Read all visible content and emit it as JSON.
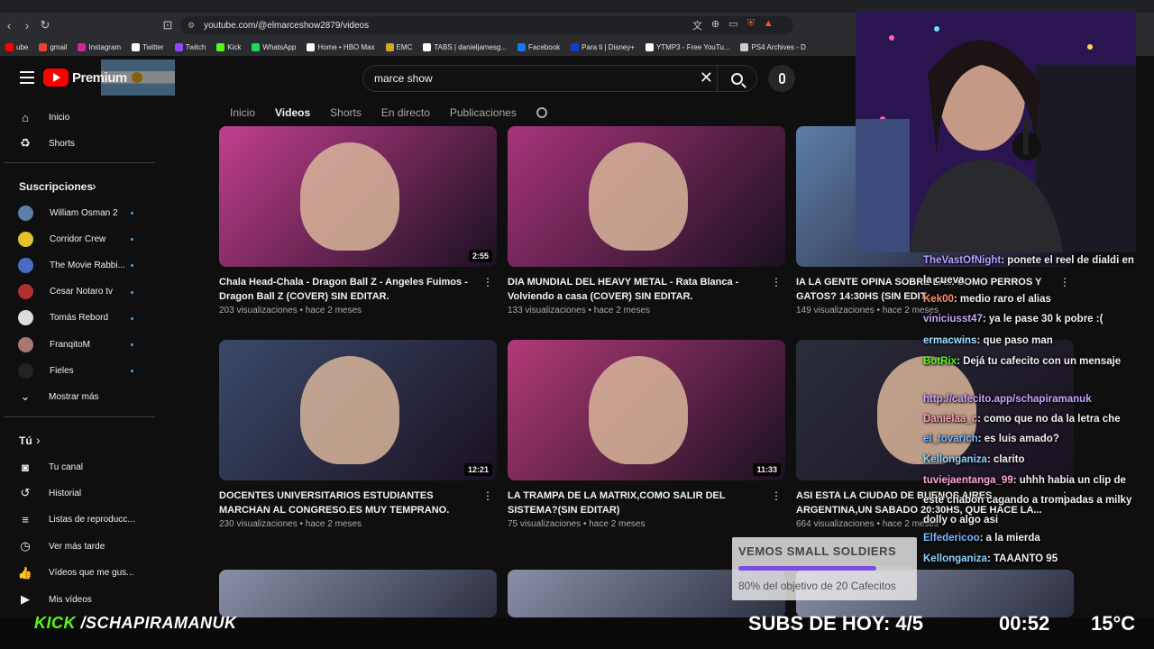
{
  "browser": {
    "url": "youtube.com/@elmarceshow2879/videos",
    "bookmarks": [
      {
        "label": "ube",
        "color": "#ff0000"
      },
      {
        "label": "gmail",
        "color": "#ea4335"
      },
      {
        "label": "Instagram",
        "color": "#d6249f"
      },
      {
        "label": "Twitter",
        "color": "#ffffff"
      },
      {
        "label": "Twitch",
        "color": "#9146ff"
      },
      {
        "label": "Kick",
        "color": "#53fc18"
      },
      {
        "label": "WhatsApp",
        "color": "#25d366"
      },
      {
        "label": "Home • HBO Max",
        "color": "#ffffff"
      },
      {
        "label": "EMC",
        "color": "#d4a72c"
      },
      {
        "label": "TABS | danieljamesg...",
        "color": "#ffffff"
      },
      {
        "label": "Facebook",
        "color": "#1877f2"
      },
      {
        "label": "Para ti | Disney+",
        "color": "#113ccf"
      },
      {
        "label": "YTMP3 - Free YouTu...",
        "color": "#ffffff"
      },
      {
        "label": "PS4 Archives - D",
        "color": "#cccccc"
      }
    ]
  },
  "header": {
    "logo_text": "Premium",
    "search_value": "marce show"
  },
  "channel_tabs": [
    "Inicio",
    "Videos",
    "Shorts",
    "En directo",
    "Publicaciones"
  ],
  "channel_tab_active": "Videos",
  "sidebar": {
    "main": [
      {
        "label": "Inicio",
        "icon": "home-icon",
        "glyph": "⌂"
      },
      {
        "label": "Shorts",
        "icon": "shorts-icon",
        "glyph": "♻"
      }
    ],
    "subs_heading": "Suscripciones",
    "subs": [
      {
        "label": "William Osman 2",
        "color": "#5b7fa8"
      },
      {
        "label": "Corridor Crew",
        "color": "#e2c12b"
      },
      {
        "label": "The Movie Rabbi...",
        "color": "#4a6cc7"
      },
      {
        "label": "Cesar Notaro tv",
        "color": "#b03030"
      },
      {
        "label": "Tomás Rebord",
        "color": "#dddddd"
      },
      {
        "label": "FranqitoM",
        "color": "#aa7777"
      },
      {
        "label": "Fieles",
        "color": "#222222"
      }
    ],
    "show_more": "Mostrar más",
    "you_heading": "Tú",
    "you": [
      {
        "label": "Tu canal",
        "icon": "channel-icon",
        "glyph": "◙"
      },
      {
        "label": "Historial",
        "icon": "history-icon",
        "glyph": "↺"
      },
      {
        "label": "Listas de reproducc...",
        "icon": "playlists-icon",
        "glyph": "≡"
      },
      {
        "label": "Ver más tarde",
        "icon": "watch-later-icon",
        "glyph": "◷"
      },
      {
        "label": "Vídeos que me gus...",
        "icon": "like-icon",
        "glyph": "👍"
      },
      {
        "label": "Mis vídeos",
        "icon": "my-videos-icon",
        "glyph": "▶"
      }
    ]
  },
  "videos": [
    {
      "title": "Chala Head-Chala - Dragon Ball Z - Angeles Fuimos - Dragon Ball Z (COVER) SIN EDITAR.",
      "views": "203 visualizaciones",
      "age": "hace 2 meses",
      "duration": "2:55",
      "thumb": "#c23e8e"
    },
    {
      "title": "DIA MUNDIAL DEL HEAVY METAL  - Rata Blanca - Volviendo a casa  (COVER) SIN EDITAR.",
      "views": "133 visualizaciones",
      "age": "hace 2 meses",
      "duration": "",
      "thumb": "#a7347a"
    },
    {
      "title": "IA LA GENTE OPINA SOBRE LA... COMO PERROS Y GATOS? 14:30HS (SIN EDIT...",
      "views": "149 visualizaciones",
      "age": "hace 2 meses",
      "duration": "",
      "thumb": "#5c7ea8"
    },
    {
      "title": "DOCENTES UNIVERSITARIOS ESTUDIANTES MARCHAN AL CONGRESO.ES MUY TEMPRANO. ACT...",
      "views": "230 visualizaciones",
      "age": "hace 2 meses",
      "duration": "12:21",
      "thumb": "#3a4a6a"
    },
    {
      "title": "LA TRAMPA DE LA MATRIX,COMO SALIR DEL SISTEMA?(SIN EDITAR)",
      "views": "75 visualizaciones",
      "age": "hace 2 meses",
      "duration": "11:33",
      "thumb": "#b23a78"
    },
    {
      "title": "ASI ESTA LA CIUDAD DE BUENOS AIRES ARGENTINA,UN SABADO 20:30HS, QUE HACE LA...",
      "views": "664 visualizaciones",
      "age": "hace 2 meses",
      "duration": "",
      "thumb": "#2a2e3a"
    }
  ],
  "chat": [
    {
      "user": "TheVastOfNight",
      "color": "#b9a2ff",
      "text": ": ponete el reel de dialdi en la cueva"
    },
    {
      "user": "Kek00",
      "color": "#ff8f6b",
      "text": ": medio raro el alias"
    },
    {
      "user": "viniciusst47",
      "color": "#c9a2ff",
      "text": ": ya le pase 30 k pobre :("
    },
    {
      "user": "ermacwins",
      "color": "#9ee3ff",
      "text": ": que paso man"
    },
    {
      "user": "BotRix",
      "color": "#53fc18",
      "text": ": Dejá tu cafecito con un mensaje"
    },
    {
      "user": "",
      "color": "#c9a2ff",
      "text": "http://cafecito.app/schapiramanuk"
    },
    {
      "user": "Danielaa_c",
      "color": "#ff9fb0",
      "text": ": como que no da la letra che"
    },
    {
      "user": "el_tovarich",
      "color": "#7ab8ff",
      "text": ": es luis amado?"
    },
    {
      "user": "Kellonganiza",
      "color": "#8fd3ff",
      "text": ": clarito"
    },
    {
      "user": "tuviejaentanga_99",
      "color": "#ffa8d5",
      "text": ": uhhh habia un clip de este chabon cagando a trompadas a milky dolly o algo asi"
    },
    {
      "user": "Elfedericoo",
      "color": "#7ab8ff",
      "text": ": a la mierda"
    },
    {
      "user": "Kellonganiza",
      "color": "#8fd3ff",
      "text": ": TAAANTO 95"
    }
  ],
  "goal": {
    "title": "VEMOS SMALL SOLDIERS",
    "progress_pct": 80,
    "text": "80% del objetivo de 20 Cafecitos"
  },
  "overlay": {
    "kick_brand": "KICK",
    "kick_handle": "/SCHAPIRAMANUK",
    "subs": "SUBS DE HOY: 4/5",
    "timer": "00:52",
    "temp": "15°C"
  },
  "colors": {
    "yt_bg": "#0f0f0f",
    "accent_red": "#ff0000",
    "kick_green": "#53fc18",
    "goal_purple": "#7d4de0"
  }
}
